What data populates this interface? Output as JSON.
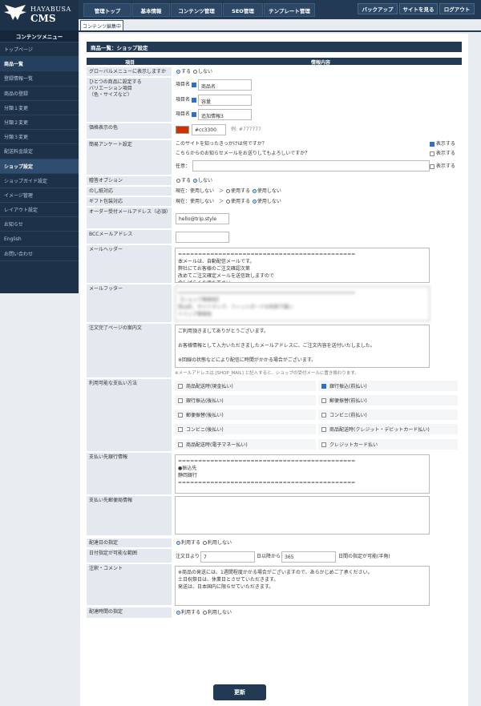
{
  "logo": {
    "line1": "HAYABUSA",
    "line2": "CMS"
  },
  "topnav": [
    {
      "label": "管理トップ"
    },
    {
      "label": "基本情報"
    },
    {
      "label": "コンテンツ管理"
    },
    {
      "label": "SEO管理"
    },
    {
      "label": "テンプレート管理"
    }
  ],
  "topright": [
    {
      "label": "バックアップ"
    },
    {
      "label": "サイトを見る"
    },
    {
      "label": "ログアウト"
    }
  ],
  "sidebar": {
    "header": "コンテンツメニュー",
    "items": [
      {
        "label": "トップページ",
        "style": "sub"
      },
      {
        "label": "商品一覧",
        "style": "bold"
      },
      {
        "label": "登録情報一覧",
        "style": "sub"
      },
      {
        "label": "商品の登録",
        "style": "sub"
      },
      {
        "label": "分類１変更",
        "style": "sub"
      },
      {
        "label": "分類２変更",
        "style": "sub"
      },
      {
        "label": "分類３変更",
        "style": "sub"
      },
      {
        "label": "配送料金設定",
        "style": "sub"
      },
      {
        "label": "ショップ設定",
        "style": "active"
      },
      {
        "label": "ショップガイド設定",
        "style": "sub"
      },
      {
        "label": "イメージ管理",
        "style": "sub"
      },
      {
        "label": "レイアウト設定",
        "style": "sub"
      },
      {
        "label": "お知らせ",
        "style": "sub"
      },
      {
        "label": "English",
        "style": "sub"
      },
      {
        "label": "お問い合わせ",
        "style": "sub"
      }
    ]
  },
  "tab": "コンテンツ編集中",
  "page_title": "商品一覧：ショップ設定",
  "columns": {
    "item": "項目",
    "info": "情報内容"
  },
  "labels": {
    "global_menu": "グローバルメニューに表示しますか",
    "variation": "ひとつの商品に設定する\nバリエーション項目\n（色・サイズなど）",
    "price_color": "価格表示の色",
    "survey": "簡易アンケート設定",
    "gift_option": "贈答オプション",
    "noshi": "のし紙対応",
    "gift_wrap": "ギフト包装対応",
    "order_email": "オーダー受付メールアドレス（必須）",
    "bcc_email": "BCCメールアドレス",
    "mail_header": "メールヘッダー",
    "mail_footer": "メールフッター",
    "complete_msg": "注文完了ページの案内文",
    "payment": "利用可能な支払い方法",
    "bank_info": "支払い先銀行情報",
    "postal_info": "支払い先郵便局情報",
    "delivery_date": "配達日の指定",
    "date_range": "日付指定が可能な範囲",
    "notes": "注釈・コメント",
    "delivery_time": "配達時間の指定"
  },
  "opts": {
    "show": "する",
    "hide": "しない",
    "use": "利用する",
    "nouse": "利用しない",
    "current_off": "現在：使用しない　＞",
    "enable": "使用する",
    "disable": "使用しない"
  },
  "variation": {
    "prefix": "項目名",
    "items": [
      "商品名",
      "容量",
      "追加情報3"
    ]
  },
  "price_color": {
    "value": "#cc3300",
    "hint": "例: #777777",
    "swatch": "#cc3300"
  },
  "survey": {
    "q1": "このサイトを知ったきっかけは何ですか？",
    "q2": "こちらからのお知らせメールをお送りしてもよろしいですか？",
    "free": "任意：",
    "show": "表示する"
  },
  "order_email": "hello@trip.style",
  "mail_header": "============================================\n本メールは、自動配信メールです。\n弊社にてお客様のご注文確認次第\n改めてご注文確定メールを送信致しますので\n今しばらくお待ち下さい。",
  "mail_footer": "============================================\n【ショップ事務局】\n西山町、サイトマップ、フィットボードの利用下属い\nトリップ事務局",
  "complete_msg": "ご利用頂きましてありがとうございます。\n\nお客様情報として入力いただきましたメールアドレスに、ご注文内容を送付いたしました。\n\n※回線の状態などにより配信に時間がかかる場合がございます。",
  "complete_note": "※メールアドレスは [SHOP_MAIL] と記入すると、ショップの受付メールに置き換わります。",
  "payments": [
    {
      "label": "商品配送時(現金払い)",
      "checked": false
    },
    {
      "label": "銀行振込(前払い)",
      "checked": true
    },
    {
      "label": "銀行振込(後払い)",
      "checked": false
    },
    {
      "label": "郵便振替(前払い)",
      "checked": false
    },
    {
      "label": "郵便振替(後払い)",
      "checked": false
    },
    {
      "label": "コンビニ(前払い)",
      "checked": false
    },
    {
      "label": "コンビニ(後払い)",
      "checked": false
    },
    {
      "label": "商品配送時(クレジット・デビットカード払い)",
      "checked": false
    },
    {
      "label": "商品配送時(電子マネー払い)",
      "checked": false
    },
    {
      "label": "クレジットカード払い",
      "checked": false
    }
  ],
  "bank_info": "============================================\n●振込先\n静岡銀行\n============================================",
  "date_range": {
    "prefix": "注文日より",
    "from": "7",
    "mid": "日以降から",
    "to": "365",
    "suffix": "日間の指定が可能(半角)"
  },
  "notes": "※商品の発送には、1週間程度かかる場合がございますので、あらかじめご了承ください。\n土日祝祭日は、休業日とさせていただきます。\n発送は、日本国内に限らせていただきます。",
  "update_button": "更新"
}
